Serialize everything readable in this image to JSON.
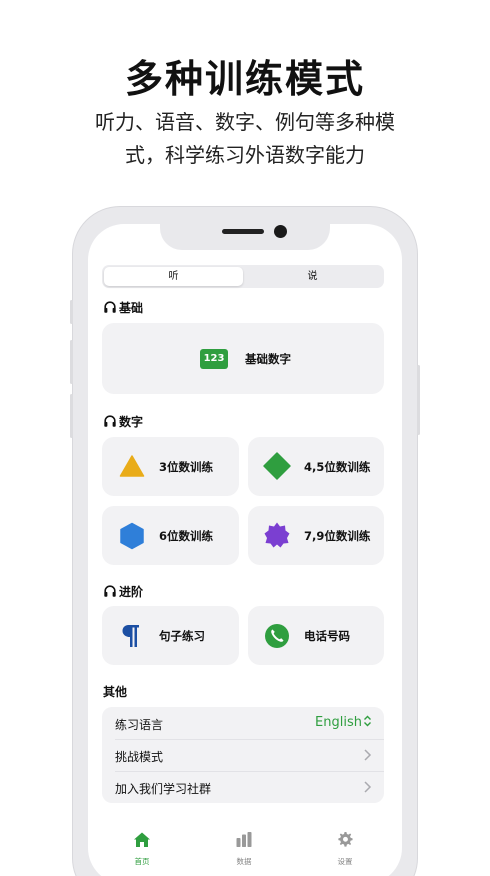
{
  "promo": {
    "title": "多种训练模式",
    "subtitle_line1": "听力、语音、数字、例句等多种模",
    "subtitle_line2": "式，科学练习外语数字能力"
  },
  "segmented": {
    "tabs": [
      "听",
      "说"
    ],
    "selected": "听"
  },
  "sections": {
    "basic": "基础",
    "digits": "数字",
    "advanced": "进阶",
    "other": "其他"
  },
  "cards": {
    "basic_numbers": {
      "badge": "123",
      "label": "基础数字"
    },
    "three_digit": {
      "label": "3位数训练",
      "icon": "triangle-icon",
      "color": "#e9ac19"
    },
    "four_five_digit": {
      "label": "4,5位数训练",
      "icon": "diamond-icon",
      "color": "#2f9e3f"
    },
    "six_digit": {
      "label": "6位数训练",
      "icon": "hexagon-icon",
      "color": "#2f7fd9"
    },
    "seven_nine_digit": {
      "label": "7,9位数训练",
      "icon": "star-seal-icon",
      "color": "#7b3fd1"
    },
    "sentence": {
      "label": "句子练习",
      "icon": "pilcrow-icon",
      "color": "#1c4fa3"
    },
    "phone": {
      "label": "电话号码",
      "icon": "phone-icon",
      "color": "#2f9e3f"
    }
  },
  "settings_list": [
    {
      "label": "练习语言",
      "value": "English"
    },
    {
      "label": "挑战模式",
      "value": ""
    },
    {
      "label": "加入我们学习社群",
      "value": ""
    }
  ],
  "tabbar": [
    {
      "label": "首页",
      "icon": "home-icon",
      "active": true
    },
    {
      "label": "数据",
      "icon": "bar-chart-icon",
      "active": false
    },
    {
      "label": "设置",
      "icon": "gear-icon",
      "active": false
    }
  ],
  "colors": {
    "accent": "#2f9e3f"
  }
}
